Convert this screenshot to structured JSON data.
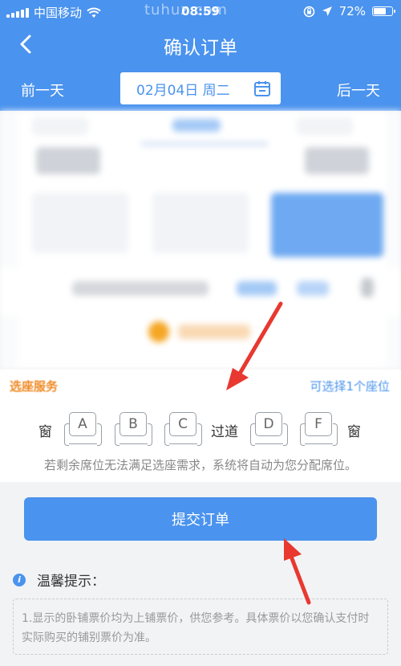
{
  "status_bar": {
    "carrier": "中国移动",
    "time": "08:59",
    "watermark": "tuhuz.com",
    "battery": "72%",
    "battery_level": 0.72
  },
  "header": {
    "title": "确认订单",
    "back_icon": "chevron-left-icon"
  },
  "date_bar": {
    "prev_label": "前一天",
    "date": "02月04日 周二",
    "next_label": "后一天",
    "calendar_icon": "calendar-icon"
  },
  "seat_service": {
    "title": "选座服务",
    "right_note": "可选择1个座位",
    "row": {
      "window_left": "窗",
      "aisle": "过道",
      "window_right": "窗",
      "seats": [
        "A",
        "B",
        "C",
        "D",
        "F"
      ]
    },
    "note": "若剩余席位无法满足选座需求，系统将自动为您分配席位。"
  },
  "submit_label": "提交订单",
  "tips": {
    "title": "温馨提示：",
    "text": "1.显示的卧铺票价均为上铺票价，供您参考。具体票价以您确认支付时实际购买的铺别票价为准。"
  },
  "colors": {
    "primary": "#4a93ee",
    "accent_orange": "#f08a24",
    "annotation_red": "#e8382f"
  }
}
